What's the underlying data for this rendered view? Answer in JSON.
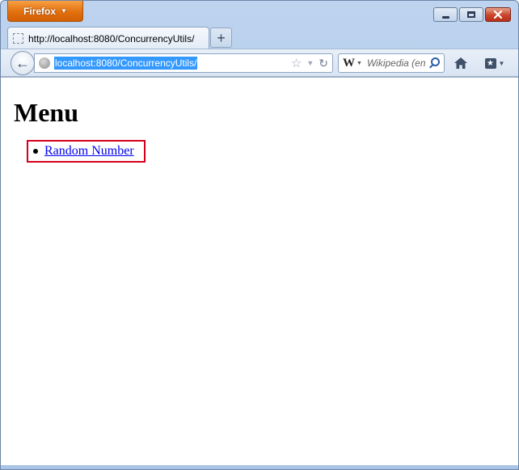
{
  "app_menu": {
    "label": "Firefox",
    "caret": "▼"
  },
  "tabs": [
    {
      "title": "http://localhost:8080/ConcurrencyUtils/"
    }
  ],
  "new_tab_label": "+",
  "nav": {
    "back_glyph": "←",
    "url": "localhost:8080/ConcurrencyUtils/"
  },
  "search": {
    "engine_glyph": "W",
    "placeholder": "Wikipedia (en"
  },
  "page": {
    "heading": "Menu",
    "menu_items": [
      {
        "label": "Random Number"
      }
    ]
  },
  "colors": {
    "link": "#0000ee",
    "highlight": "#d4001c",
    "url_selection": "#3399ff"
  }
}
